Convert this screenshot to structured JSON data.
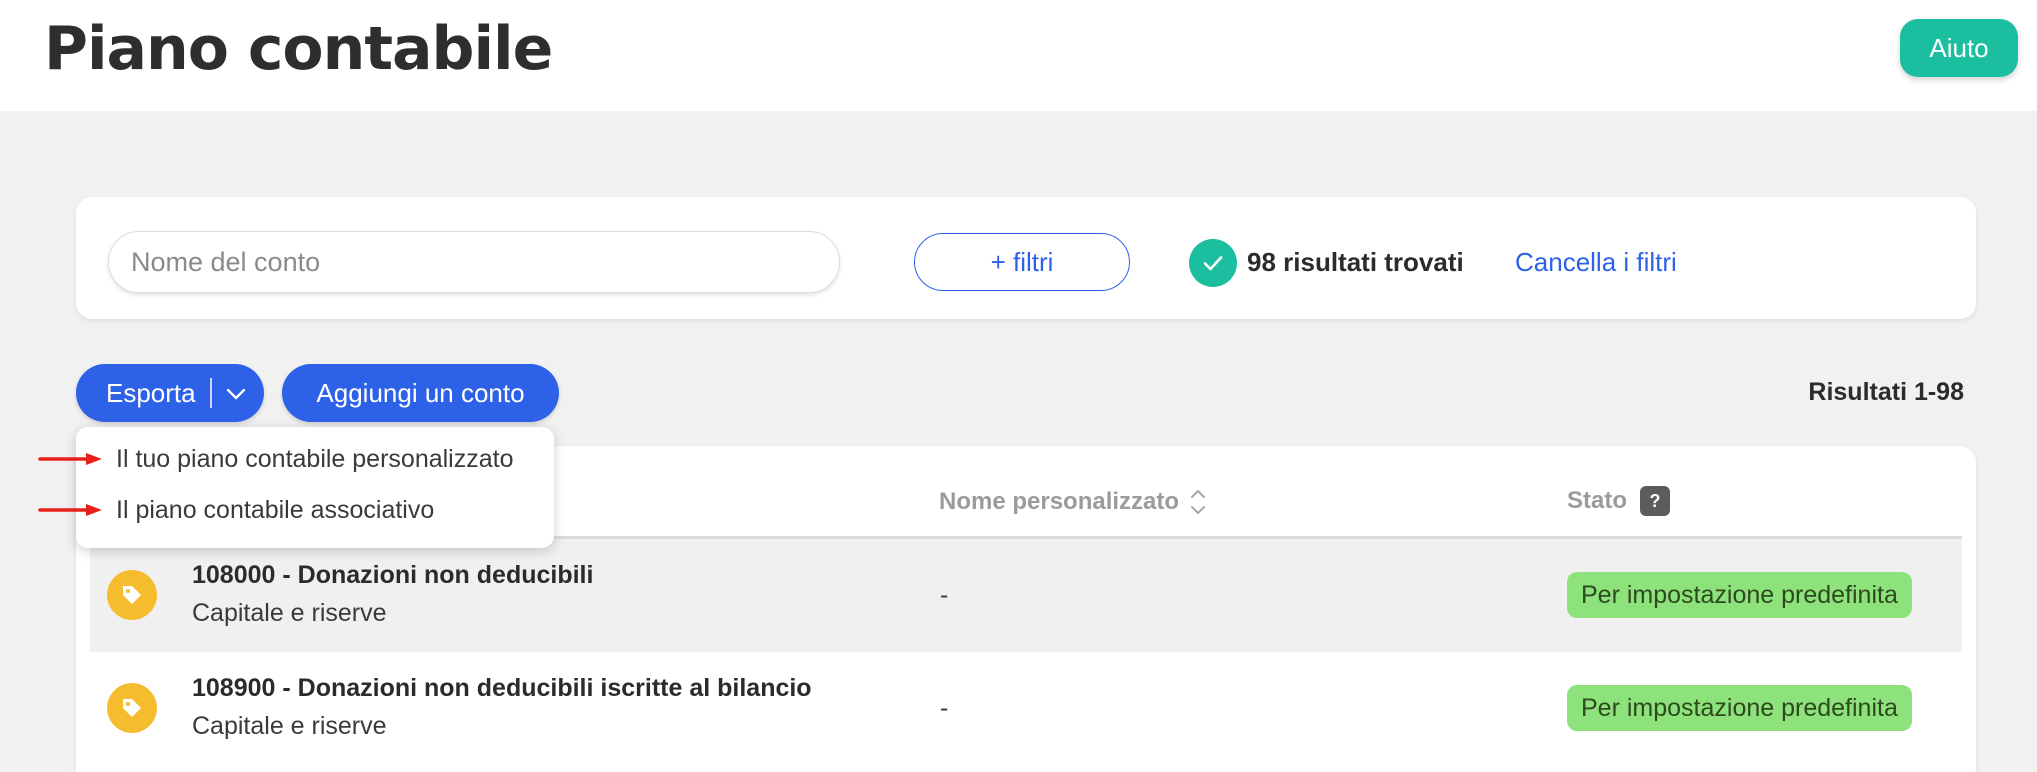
{
  "page": {
    "title": "Piano contabile",
    "help_label": "Aiuto"
  },
  "filters": {
    "search_placeholder": "Nome del conto",
    "search_value": "",
    "add_filters_label": "+ filtri",
    "results_found": "98 risultati trovati",
    "clear_filters_label": "Cancella i filtri"
  },
  "toolbar": {
    "export_label": "Esporta",
    "add_account_label": "Aggiungi un conto",
    "results_range": "Risultati 1-98"
  },
  "export_menu": {
    "items": [
      {
        "label": "Il tuo piano contabile personalizzato"
      },
      {
        "label": "Il piano contabile associativo"
      }
    ]
  },
  "table": {
    "columns": {
      "custom_name": "Nome personalizzato",
      "status": "Stato",
      "status_help": "?"
    },
    "rows": [
      {
        "account": "108000 - Donazioni non deducibili",
        "category": "Capitale e riserve",
        "custom_name": "-",
        "status": "Per impostazione predefinita"
      },
      {
        "account": "108900 - Donazioni non deducibili iscritte al bilancio",
        "category": "Capitale e riserve",
        "custom_name": "-",
        "status": "Per impostazione predefinita"
      }
    ]
  },
  "colors": {
    "primary": "#2d62e8",
    "success": "#1bbf9f",
    "tag_icon": "#f5bd2e",
    "status_badge": "#8ee27b",
    "annotation_arrow": "#e8201a"
  },
  "icons": {
    "check": "check-icon",
    "chevron": "chevron-down-icon",
    "sort": "sort-icon",
    "tag": "tag-icon",
    "help": "help-icon",
    "arrow": "red-arrow-icon"
  }
}
